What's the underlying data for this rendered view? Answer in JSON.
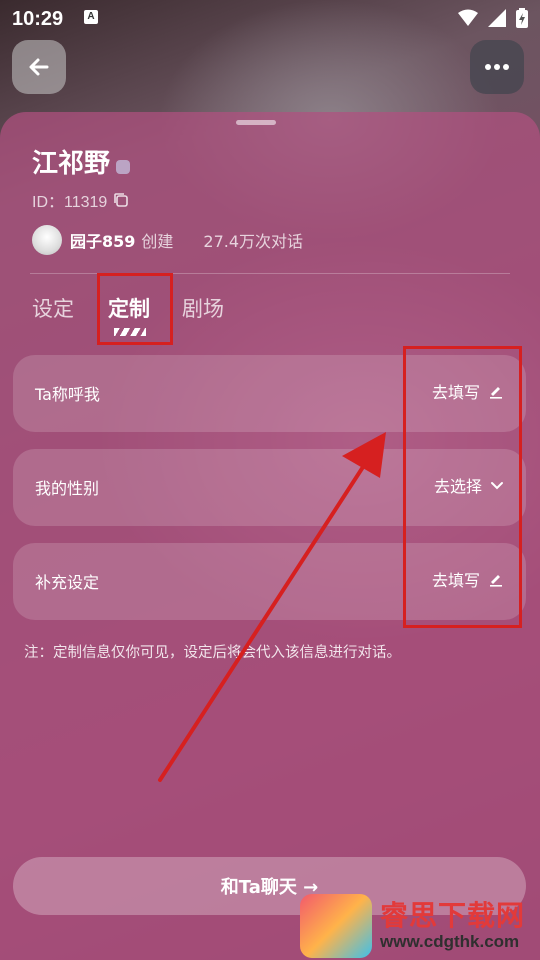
{
  "status": {
    "time": "10:29"
  },
  "header": {
    "back_icon": "arrow-left-icon",
    "more_icon": "more-horizontal-icon"
  },
  "character": {
    "name": "江祁野",
    "id_label": "ID：11319",
    "creator_name": "园子859",
    "creator_suffix": "创建",
    "dialog_count": "27.4万次对话"
  },
  "tabs": [
    {
      "label": "设定"
    },
    {
      "label": "定制"
    },
    {
      "label": "剧场"
    }
  ],
  "cards": [
    {
      "label": "Ta称呼我",
      "action": "去填写",
      "icon": "pencil-icon"
    },
    {
      "label": "我的性别",
      "action": "去选择",
      "icon": "chevron-down-icon"
    },
    {
      "label": "补充设定",
      "action": "去填写",
      "icon": "pencil-icon"
    }
  ],
  "note": "注：定制信息仅你可见，设定后将会代入该信息进行对话。",
  "chat_button": {
    "label": "和Ta聊天 →"
  },
  "watermark": {
    "title": "睿思下载网",
    "url": "www.cdgthk.com"
  },
  "colors": {
    "annotation_red": "#d62020",
    "sheet": "#b05080"
  }
}
